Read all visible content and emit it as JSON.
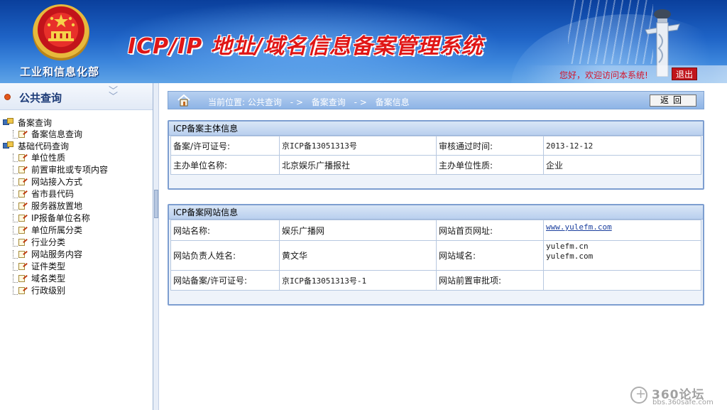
{
  "header": {
    "org_name": "工业和信息化部",
    "system_title": "ICP/IP 地址/域名信息备案管理系统",
    "welcome": "您好，欢迎访问本系统!",
    "logout_label": "退出"
  },
  "sidebar": {
    "title": "公共查询",
    "groups": [
      {
        "label": "备案查询",
        "items": [
          "备案信息查询"
        ]
      },
      {
        "label": "基础代码查询",
        "items": [
          "单位性质",
          "前置审批或专项内容",
          "网站接入方式",
          "省市县代码",
          "服务器放置地",
          "IP报备单位名称",
          "单位所属分类",
          "行业分类",
          "网站服务内容",
          "证件类型",
          "域名类型",
          "行政级别"
        ]
      }
    ]
  },
  "breadcrumb": {
    "prefix": "当前位置: 公共查询",
    "sep": "- >",
    "level2": "备案查询",
    "level3": "备案信息",
    "back_label": "返回"
  },
  "subject_panel": {
    "title": "ICP备案主体信息",
    "rows": [
      {
        "label1": "备案/许可证号:",
        "value1": "京ICP备13051313号",
        "label2": "审核通过时间:",
        "value2": "2013-12-12"
      },
      {
        "label1": "主办单位名称:",
        "value1": "北京娱乐广播报社",
        "label2": "主办单位性质:",
        "value2": "企业"
      }
    ]
  },
  "site_panel": {
    "title": "ICP备案网站信息",
    "site_name_label": "网站名称:",
    "site_name": "娱乐广播网",
    "homepage_label": "网站首页网址:",
    "homepage": "www.yulefm.com",
    "owner_label": "网站负责人姓名:",
    "owner": "黄文华",
    "domain_label": "网站域名:",
    "domains": [
      "yulefm.cn",
      "yulefm.com"
    ],
    "license_label": "网站备案/许可证号:",
    "license": "京ICP备13051313号-1",
    "preapproval_label": "网站前置审批项:",
    "preapproval": ""
  },
  "watermark": {
    "brand": "360论坛",
    "url": "bbs.360safe.com"
  }
}
